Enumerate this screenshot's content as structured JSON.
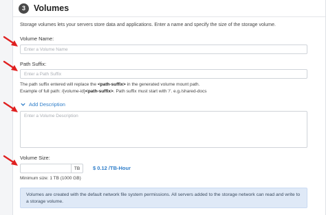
{
  "section": {
    "step_number": "3",
    "title": "Volumes",
    "description": "Storage volumes lets your servers store data and applications. Enter a name and specify the size of the storage volume."
  },
  "volume_name": {
    "label": "Volume Name:",
    "placeholder": "Enter a Volume Name",
    "value": ""
  },
  "path_suffix": {
    "label": "Path Suffix:",
    "placeholder": "Enter a Path Suffix",
    "value": "",
    "help_line1_prefix": "The path suffix entered will replace the ",
    "help_line1_bold": "<path-suffix>",
    "help_line1_suffix": " in the generated volume mount path.",
    "help_line2_prefix": "Example of full path: /{volume-id}",
    "help_line2_bold": "<path-suffix>",
    "help_line2_suffix": ". Path suffix must start with '/'. e.g./shared-docs"
  },
  "description": {
    "toggle_label": "Add Description",
    "toggle_icon": "chevron-down-icon",
    "placeholder": "Enter a Volume Description",
    "value": ""
  },
  "volume_size": {
    "label": "Volume Size:",
    "value": "",
    "unit": "TB",
    "price": "$ 0.12 /TB-Hour",
    "minimum": "Minimum size: 1 TB (1000 GB)"
  },
  "info": {
    "text": "Volumes are created with the default network file system permissions. All servers added to the storage network can read and write to a storage volume."
  },
  "colors": {
    "accent": "#2e7dc9",
    "annotation_arrow": "#e02020",
    "info_bg": "#dfe9f7"
  }
}
